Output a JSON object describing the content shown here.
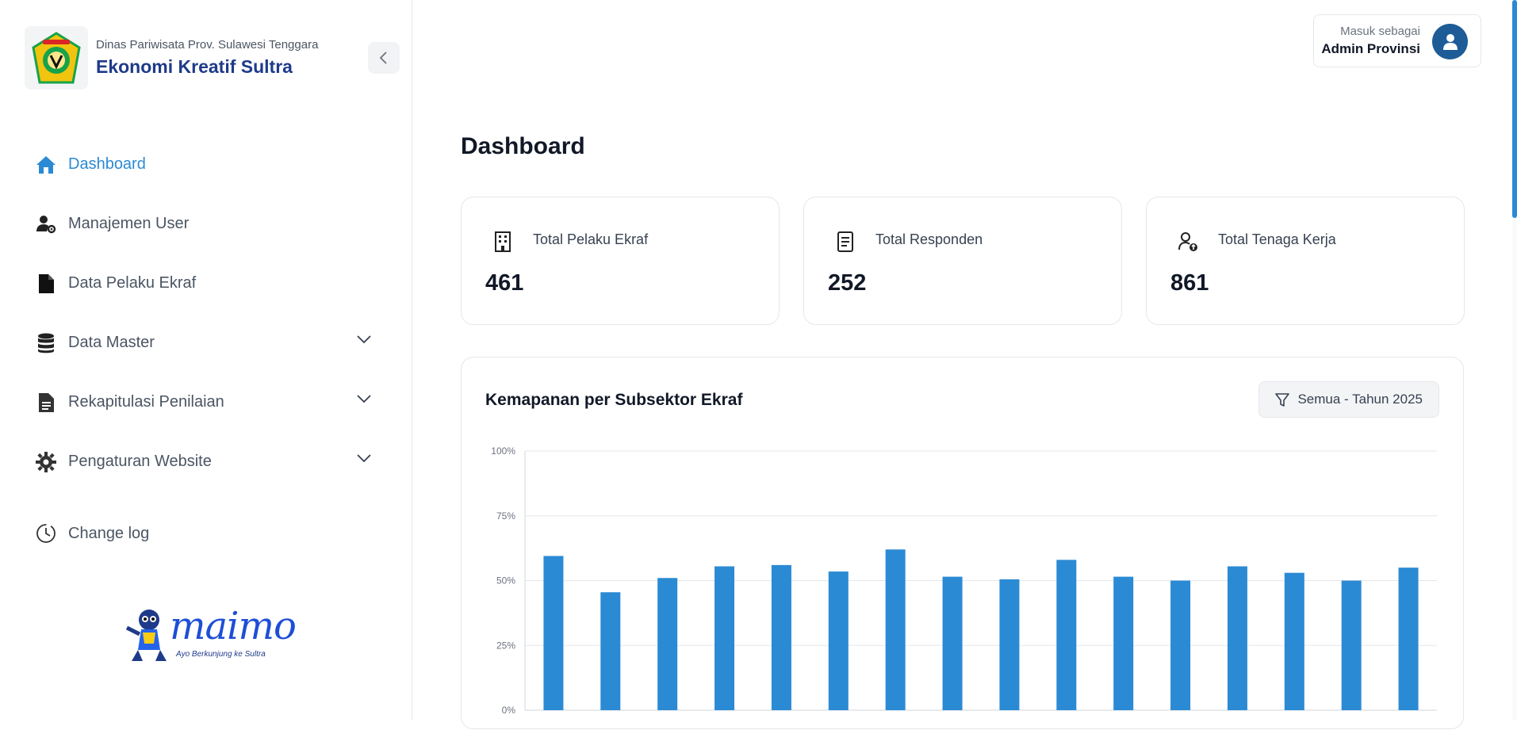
{
  "brand": {
    "subtitle": "Dinas Pariwisata Prov. Sulawesi Tenggara",
    "title": "Ekonomi Kreatif Sultra"
  },
  "sidebar": {
    "items": [
      {
        "label": "Dashboard",
        "icon": "home-icon",
        "active": true,
        "expandable": false
      },
      {
        "label": "Manajemen User",
        "icon": "user-gear-icon",
        "active": false,
        "expandable": false
      },
      {
        "label": "Data Pelaku Ekraf",
        "icon": "file-icon",
        "active": false,
        "expandable": false
      },
      {
        "label": "Data Master",
        "icon": "database-icon",
        "active": false,
        "expandable": true
      },
      {
        "label": "Rekapitulasi Penilaian",
        "icon": "document-icon",
        "active": false,
        "expandable": true
      },
      {
        "label": "Pengaturan Website",
        "icon": "gear-icon",
        "active": false,
        "expandable": true
      }
    ],
    "changelog_label": "Change log",
    "mascot_word": "maimo",
    "mascot_tagline": "Ayo Berkunjung ke Sultra"
  },
  "user": {
    "label": "Masuk sebagai",
    "name": "Admin Provinsi"
  },
  "page": {
    "title": "Dashboard"
  },
  "stats": [
    {
      "label": "Total Pelaku Ekraf",
      "value": "461",
      "icon": "building-icon"
    },
    {
      "label": "Total Responden",
      "value": "252",
      "icon": "document-icon"
    },
    {
      "label": "Total Tenaga Kerja",
      "value": "861",
      "icon": "user-badge-icon"
    }
  ],
  "chart_card": {
    "title": "Kemapanan per Subsektor Ekraf",
    "filter_label": "Semua - Tahun 2025"
  },
  "colors": {
    "accent": "#2b8ad4",
    "brand": "#1e3a8a",
    "avatar": "#1d5c96"
  },
  "chart_data": {
    "type": "bar",
    "title": "Kemapanan per Subsektor Ekraf",
    "xlabel": "",
    "ylabel": "",
    "ylim": [
      0,
      100
    ],
    "yticks": [
      "0%",
      "25%",
      "50%",
      "75%",
      "100%"
    ],
    "grid": true,
    "values": [
      59.5,
      45.5,
      51,
      55.5,
      56,
      53.5,
      62,
      51.5,
      50.5,
      58,
      51.5,
      50,
      55.5,
      53,
      50,
      55
    ]
  }
}
